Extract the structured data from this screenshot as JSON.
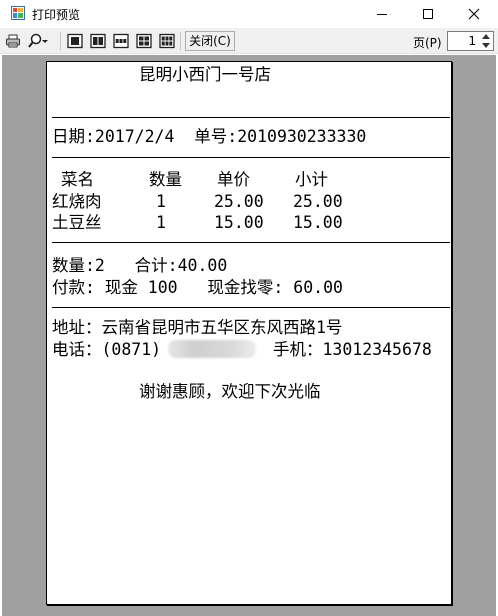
{
  "window": {
    "title": "打印预览"
  },
  "toolbar": {
    "close_label": "关闭(C)",
    "page_label": "页(P)",
    "page_value": "1",
    "icons": [
      "printer-icon",
      "zoom-icon",
      "one-page-icon",
      "two-pages-icon",
      "three-pages-icon",
      "four-pages-icon",
      "six-pages-icon"
    ]
  },
  "receipt": {
    "store_name": "昆明小西门一号店",
    "date_line": "日期:2017/2/4  单号:2010930233330",
    "headers": [
      "菜名",
      "数量",
      "单价",
      "小计"
    ],
    "items": [
      {
        "name": "红烧肉",
        "qty": "1",
        "price": "25.00",
        "subtotal": "25.00"
      },
      {
        "name": "土豆丝",
        "qty": "1",
        "price": "15.00",
        "subtotal": "15.00"
      }
    ],
    "summary_line": "数量:2   合计:40.00",
    "payment_line": "付款: 现金 100   现金找零: 60.00",
    "address_line": "地址：云南省昆明市五华区东风西路1号",
    "phone_prefix": "电话：(0871)",
    "mobile_label": "手机：13012345678",
    "thanks": "谢谢惠顾，欢迎下次光临"
  },
  "colors": {
    "preview_background": "#a0a0a0",
    "paper": "#ffffff",
    "toolbar": "#f0f0f0"
  }
}
